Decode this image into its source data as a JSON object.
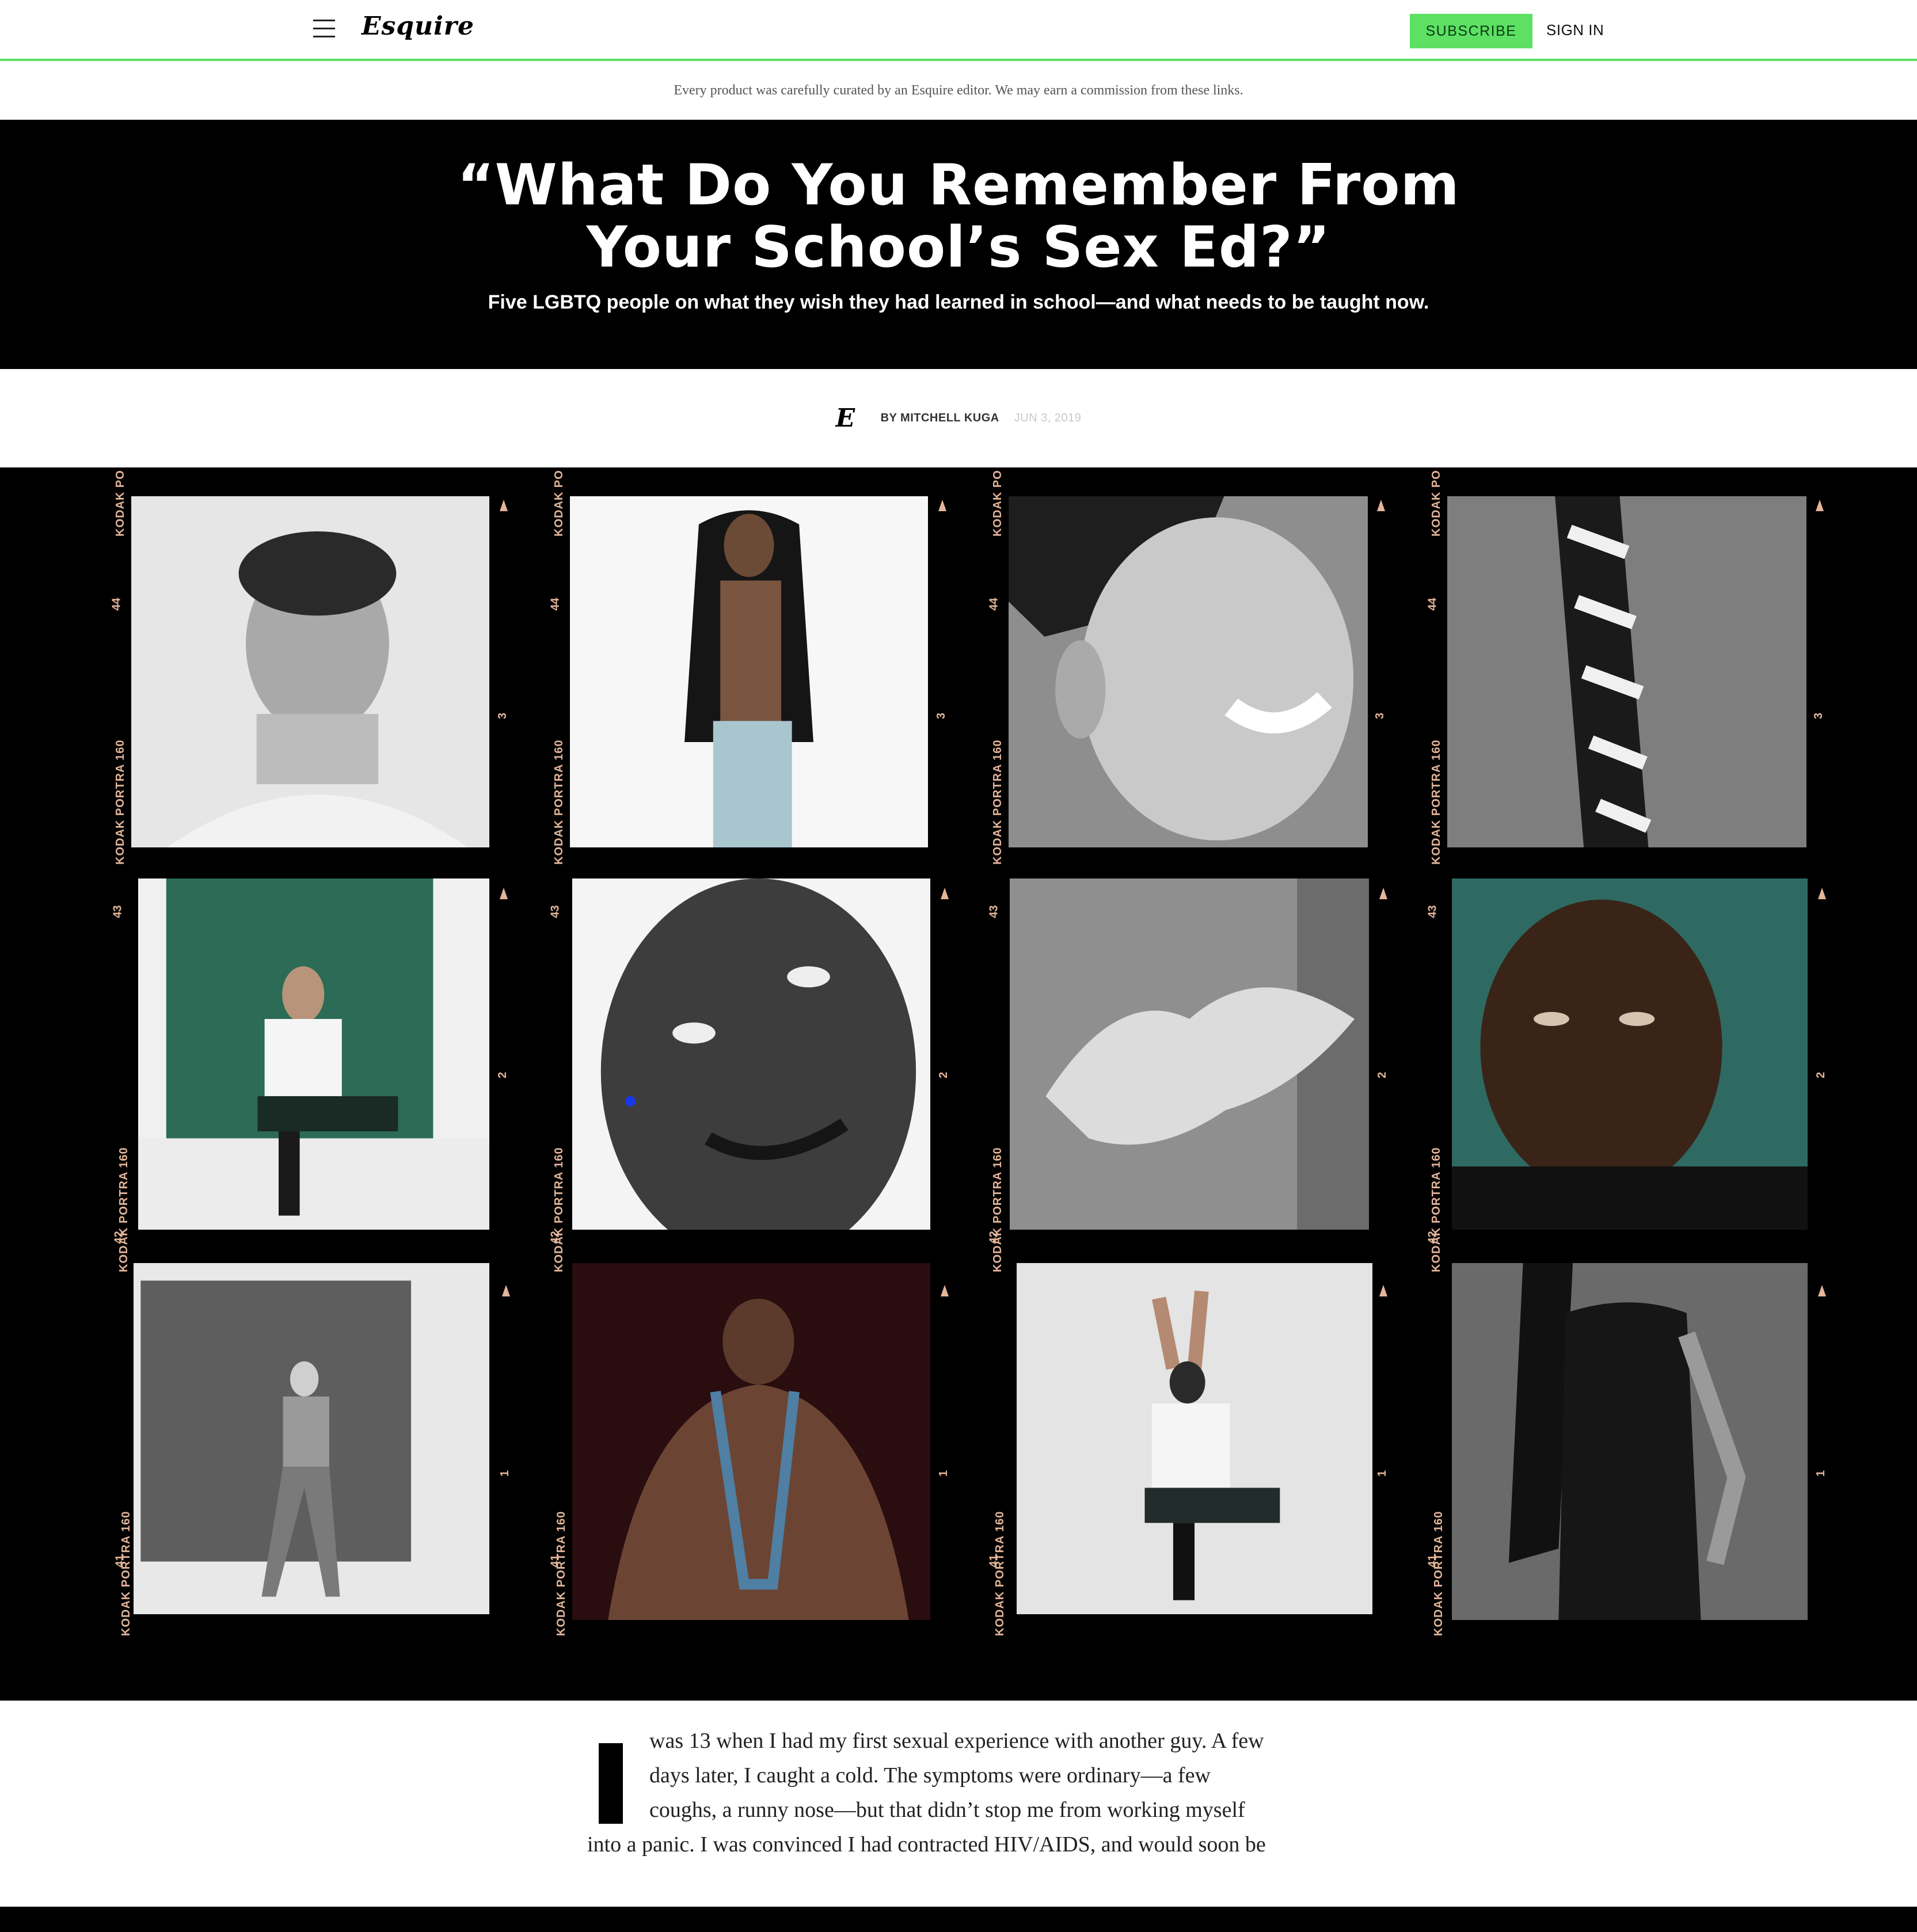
{
  "header": {
    "logo": "Esquire",
    "subscribe_label": "SUBSCRIBE",
    "signin_label": "SIGN IN"
  },
  "disclaimer": "Every product was carefully curated by an Esquire editor. We may earn a commission from these links.",
  "hero": {
    "title_line1": "“What Do You Remember From",
    "title_line2": "Your School’s Sex Ed?”",
    "dek": "Five LGBTQ people on what they wish they had learned in school—and what needs to be taught now."
  },
  "byline": {
    "logo": "E",
    "author": "BY MITCHELL KUGA",
    "date": "JUN 3, 2019"
  },
  "contact_sheet": {
    "edge_text": "KODAK PORTRA 160",
    "edge_text_top": "KODAK PO",
    "row_numbers": [
      "44",
      "43",
      "42",
      "41"
    ],
    "frame_numbers": [
      "3",
      "2",
      "1"
    ]
  },
  "article": {
    "dropcap": "I",
    "lines": [
      "was 13 when I had my first sexual experience with another guy. A few",
      "days later, I caught a cold. The symptoms were ordinary—a few",
      "coughs, a runny nose—but that didn’t stop me from working myself",
      "into a panic. I was convinced I had contracted HIV/AIDS, and would soon be"
    ]
  }
}
